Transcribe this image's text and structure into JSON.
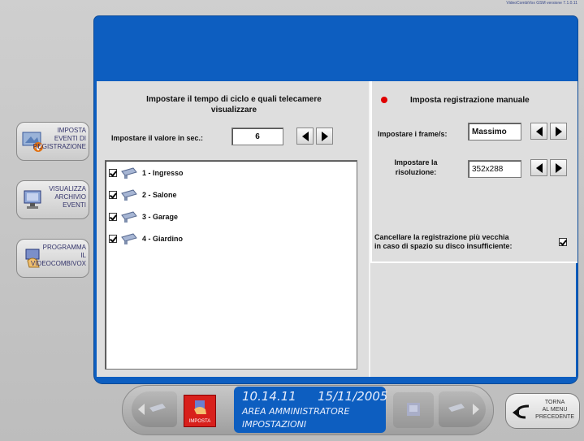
{
  "version": "VideoCombiVox GSM versione 7.1.0.11",
  "sidebar": {
    "items": [
      {
        "label_lines": [
          "IMPOSTA",
          "EVENTI DI",
          "REGISTRAZIONE"
        ],
        "icon": "event-settings-icon"
      },
      {
        "label_lines": [
          "VISUALIZZA",
          "ARCHIVIO",
          "EVENTI"
        ],
        "icon": "archive-monitor-icon"
      },
      {
        "label_lines": [
          "PROGRAMMA",
          "IL",
          "VIDEOCOMBIVOX"
        ],
        "icon": "program-hand-icon"
      }
    ]
  },
  "cycle": {
    "title_line1": "Impostare il tempo di ciclo e quali telecamere",
    "title_line2": "visualizzare",
    "value_label": "Impostare il valore in sec.:",
    "value": "6"
  },
  "cameras": [
    {
      "label": "1 - Ingresso",
      "checked": true
    },
    {
      "label": "2 - Salone",
      "checked": true
    },
    {
      "label": "3 - Garage",
      "checked": true
    },
    {
      "label": "4 - Giardino",
      "checked": true
    }
  ],
  "recording": {
    "title": "Imposta registrazione manuale",
    "status_color": "#e00000",
    "frames_label": "Impostare i frame/s:",
    "frames_value": "Massimo",
    "resolution_label_line1": "Impostare la",
    "resolution_label_line2": "risoluzione:",
    "resolution_value": "352x288",
    "overwrite_line1": "Cancellare la registrazione più vecchia",
    "overwrite_line2": "in caso di spazio su disco insufficiente:",
    "overwrite_checked": true
  },
  "bottom": {
    "imposta_label": "IMPOSTA",
    "time": "10.14.11",
    "date": "15/11/2005",
    "area": "AREA AMMINISTRATORE",
    "section": "IMPOSTAZIONI",
    "back_label_lines": [
      "TORNA",
      "AL MENU",
      "PRECEDENTE"
    ]
  },
  "colors": {
    "panel_blue": "#0d5ec0",
    "accent_red": "#e00000"
  }
}
